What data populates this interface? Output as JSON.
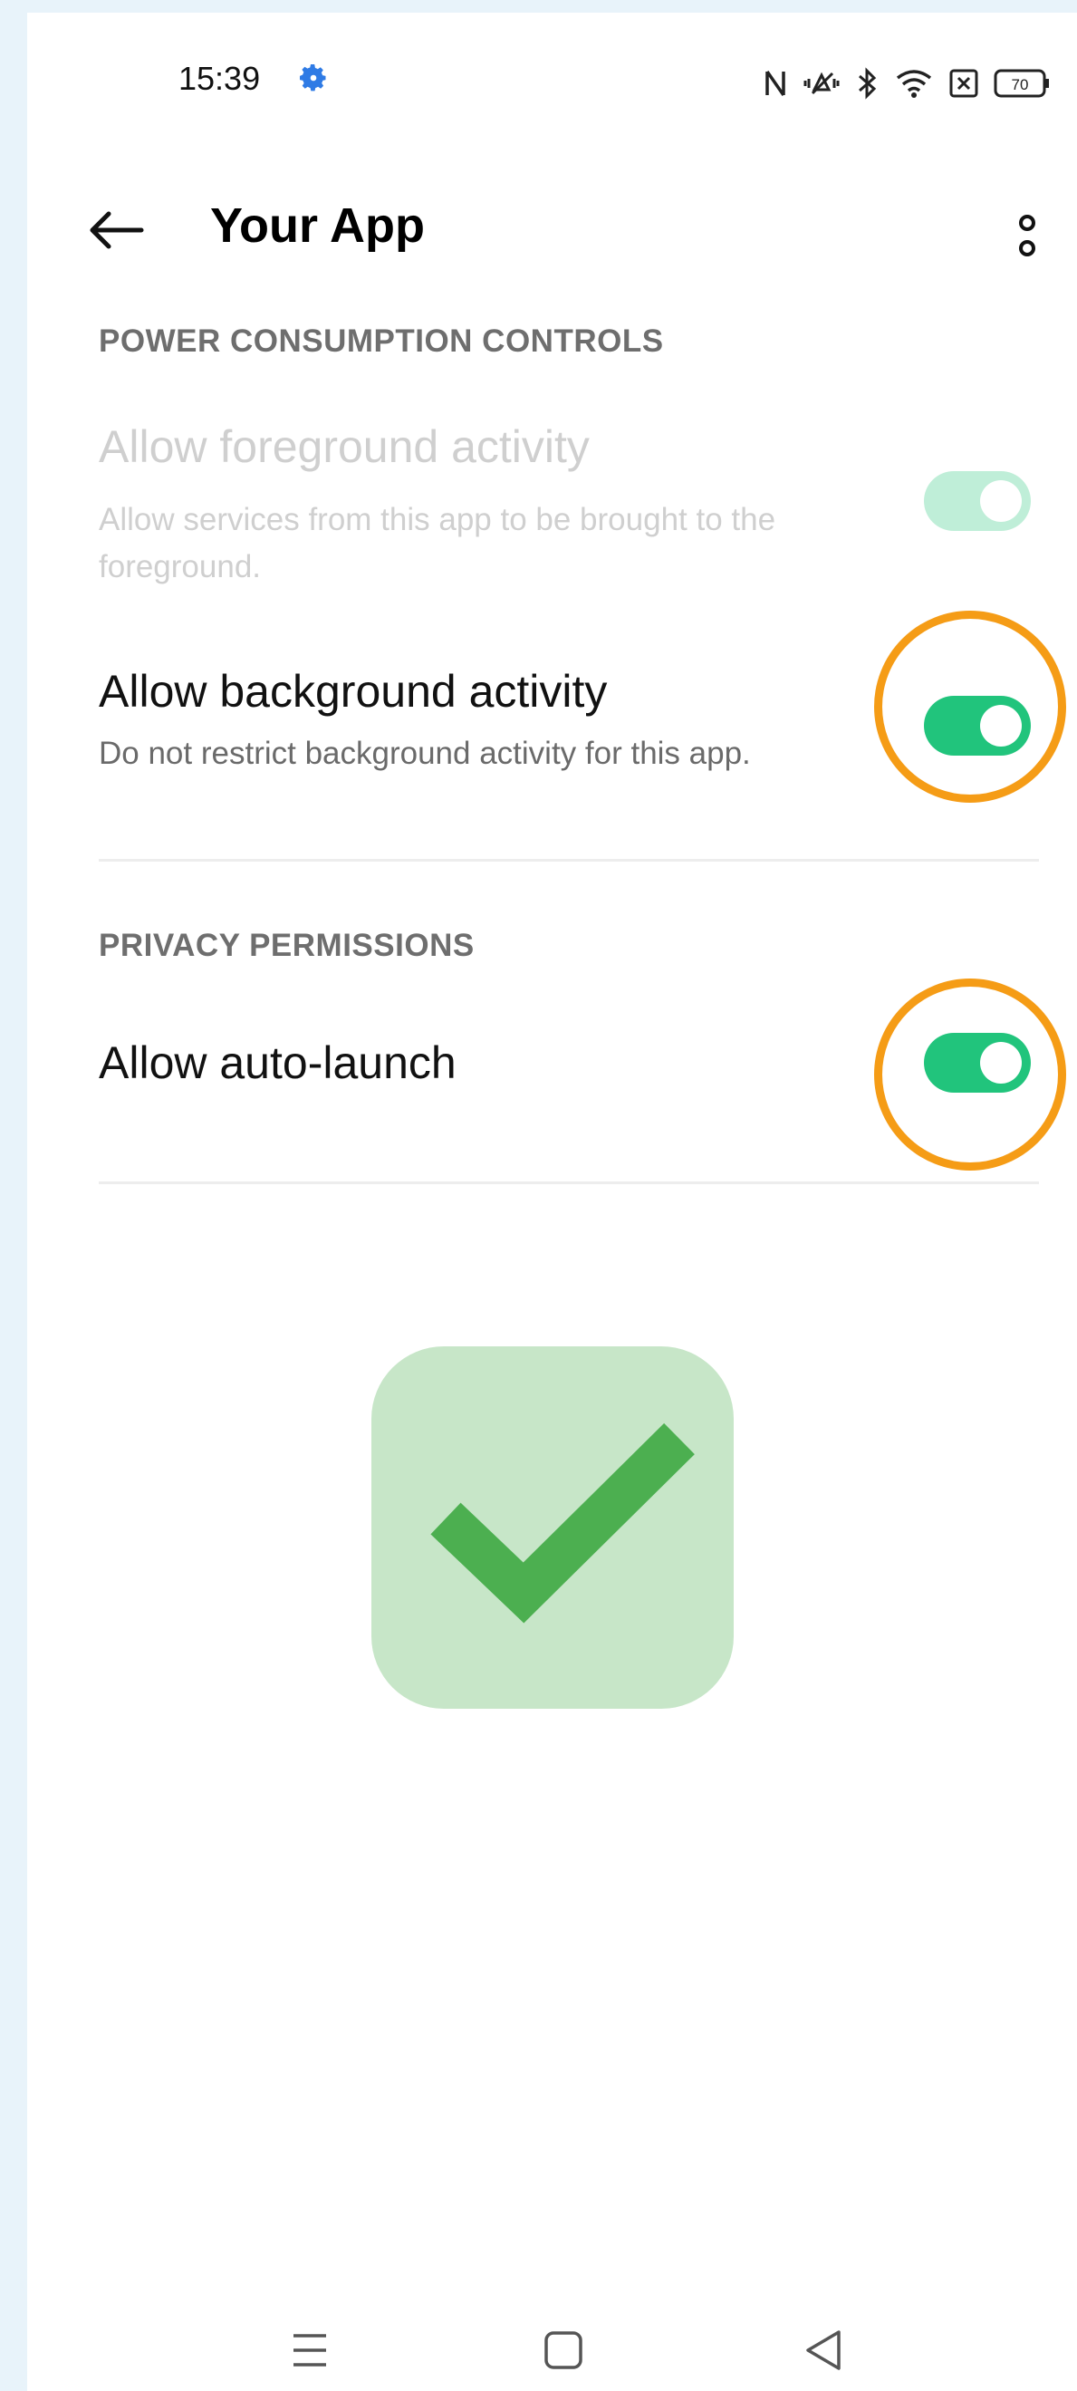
{
  "status_bar": {
    "time": "15:39",
    "battery": "70",
    "icons": [
      "settings-gear-icon",
      "nfc-icon",
      "vibrate-icon",
      "bluetooth-icon",
      "wifi-icon",
      "sim-icon",
      "battery-icon"
    ]
  },
  "app_bar": {
    "title": "Your App"
  },
  "power_section": {
    "header": "POWER CONSUMPTION CONTROLS",
    "foreground": {
      "title": "Allow foreground activity",
      "subtitle": "Allow services from this app to be brought to the foreground.",
      "enabled": true,
      "disabled_state": true
    },
    "background": {
      "title": "Allow background activity",
      "subtitle": "Do not restrict background activity for this app.",
      "enabled": true
    }
  },
  "privacy_section": {
    "header": "PRIVACY PERMISSIONS",
    "auto_launch": {
      "title": "Allow auto-launch",
      "enabled": true
    }
  },
  "colors": {
    "toggle_on": "#21c47c",
    "toggle_disabled": "#bfeed8",
    "highlight_ring": "#f59c16",
    "check_bg": "#c7e6c8",
    "check_mark": "#4caf50"
  },
  "nav_bar": {
    "icons": [
      "menu-icon",
      "home-square-icon",
      "back-triangle-icon"
    ]
  }
}
